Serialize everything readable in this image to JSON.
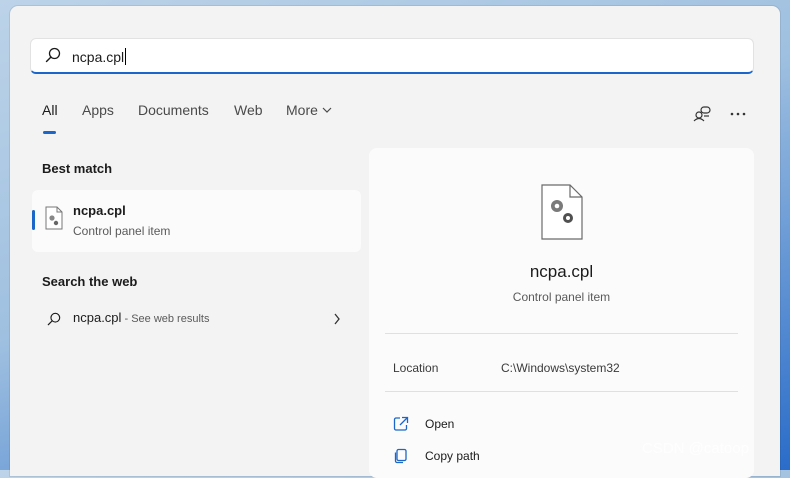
{
  "search": {
    "value": "ncpa.cpl"
  },
  "tabs": [
    {
      "label": "All"
    },
    {
      "label": "Apps"
    },
    {
      "label": "Documents"
    },
    {
      "label": "Web"
    },
    {
      "label": "More"
    }
  ],
  "left": {
    "best_match_title": "Best match",
    "best_item": {
      "title": "ncpa.cpl",
      "subtitle": "Control panel item"
    },
    "web_title": "Search the web",
    "web_item": {
      "title": "ncpa.cpl",
      "suffix": " - See web results"
    }
  },
  "detail": {
    "title": "ncpa.cpl",
    "subtitle": "Control panel item",
    "location_label": "Location",
    "location_value": "C:\\Windows\\system32",
    "actions": [
      {
        "label": "Open",
        "icon": "open-external-icon"
      },
      {
        "label": "Copy path",
        "icon": "copy-icon"
      }
    ]
  },
  "watermark": "CSDN @catoop",
  "colors": {
    "accent": "#1b66c9",
    "panel": "#f3f3f3",
    "card": "#fbfbfb"
  }
}
